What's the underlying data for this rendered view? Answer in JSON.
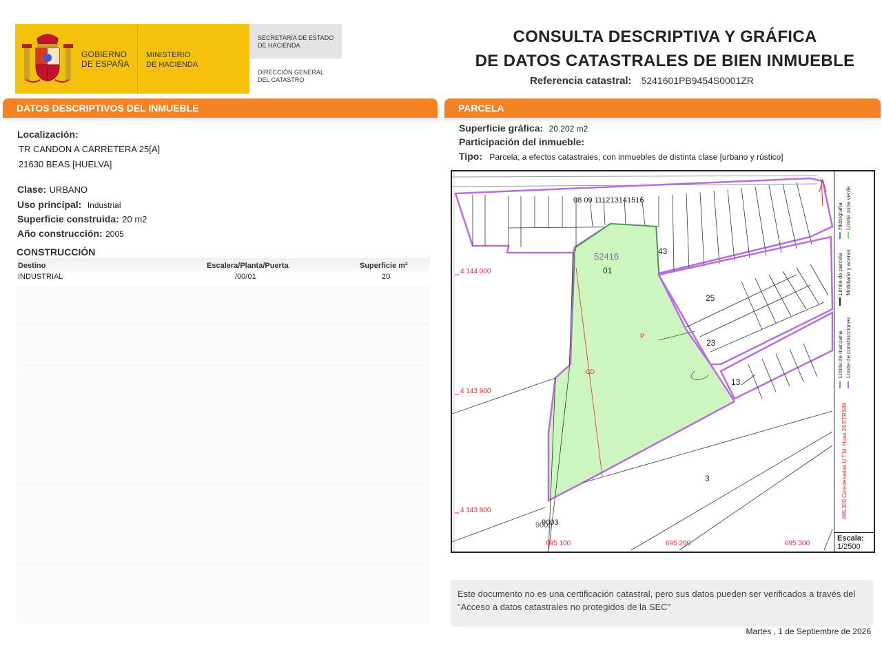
{
  "header": {
    "gobierno": [
      "GOBIERNO",
      "DE ESPAÑA"
    ],
    "ministerio": [
      "MINISTERIO",
      "DE HACIENDA"
    ],
    "secretaria": [
      "SECRETARÍA DE ESTADO",
      "DE HACIENDA"
    ],
    "direccion": [
      "DIRECCIÓN GENERAL",
      "DEL CATASTRO"
    ],
    "title_line1": "CONSULTA DESCRIPTIVA Y GRÁFICA",
    "title_line2": "DE DATOS CATASTRALES DE BIEN INMUEBLE",
    "ref_label": "Referencia catastral:",
    "ref_value": "5241601PB9454S0001ZR"
  },
  "left": {
    "section_title": "DATOS DESCRIPTIVOS DEL INMUEBLE",
    "localizacion_label": "Localización:",
    "address_line1": "TR CANDON A CARRETERA 25[A]",
    "address_line2": "21630 BEAS [HUELVA]",
    "clase_label": "Clase:",
    "clase_value": "URBANO",
    "uso_label": "Uso principal:",
    "uso_value": "Industrial",
    "superficie_label": "Superficie construida:",
    "superficie_value": "20 m2",
    "anio_label": "Año construcción:",
    "anio_value": "2005",
    "construccion_title": "CONSTRUCCIÓN",
    "table": {
      "headers": [
        "Destino",
        "Escalera/Planta/Puerta",
        "Superficie m²"
      ],
      "rows": [
        [
          "INDUSTRIAL",
          "/00/01",
          "20"
        ]
      ]
    }
  },
  "right": {
    "section_title": "PARCELA",
    "sup_grafica_label": "Superficie gráfica:",
    "sup_grafica_value": "20.202 m2",
    "participacion_label": "Participación del inmueble:",
    "tipo_label": "Tipo:",
    "tipo_value": "Parcela, a efectos catastrales, con inmuebles de distinta clase [urbano y rústico]",
    "map": {
      "parcel_ref": "52416",
      "labels": [
        "01",
        "43",
        "25",
        "23",
        "13",
        "3",
        "P",
        "CD",
        "08",
        "09",
        "11",
        "12",
        "13",
        "14",
        "15",
        "16",
        "9003",
        "9003"
      ],
      "coord_y": [
        "4 144 000",
        "4 143 900",
        "4 143 800"
      ],
      "coord_x": [
        "695 100",
        "695 200",
        "695 300"
      ],
      "legend": [
        "Límite de manzana",
        "Límite de parcela",
        "Límite de construcciones",
        "Mobiliario y aceras",
        "Límite zona verde",
        "Hidrografía"
      ],
      "coord_system": "695,300 Coordenadas U.T.M. Huso 29 ETRS89",
      "scale_label": "Escala:",
      "scale_value": "1/2500"
    }
  },
  "footer": {
    "note": "Este documento no es una certificación catastral, pero sus datos pueden ser verificados a través del \"Acceso a datos catastrales no protegidos de la SEC\"",
    "date": "Martes , 1 de Septiembre de 2026"
  },
  "colors": {
    "orange": "#f58220",
    "yellow": "#f4c20d",
    "parcel_green": "#ccf5c0",
    "block_purple": "#b86ce0",
    "coord_red": "#e8282a"
  }
}
